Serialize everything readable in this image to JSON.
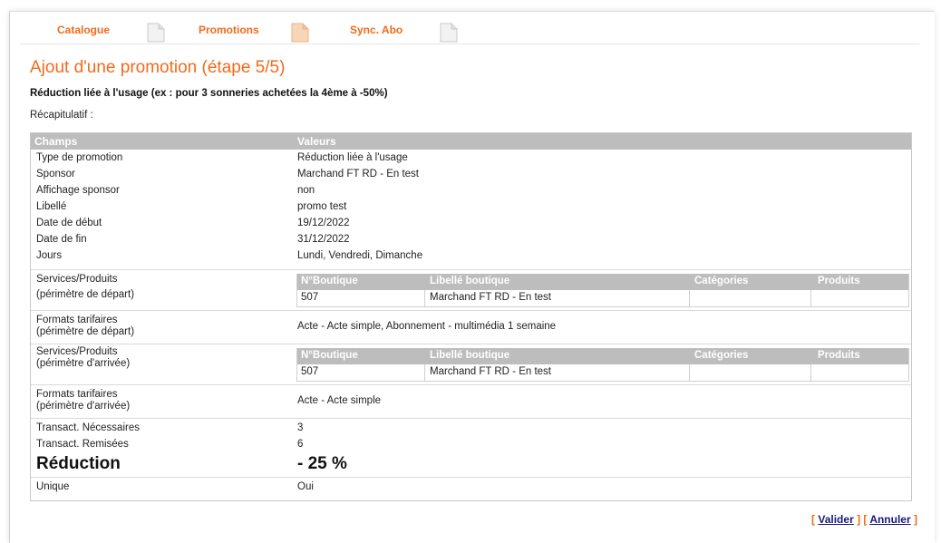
{
  "tabs": [
    "Catalogue",
    "Promotions",
    "Sync. Abo"
  ],
  "page": {
    "title": "Ajout d'une promotion (étape 5/5)",
    "subtitle": "Réduction liée à l'usage (ex : pour 3 sonneries achetées la 4ème à -50%)",
    "recap_label": "Récapitulatif :"
  },
  "table": {
    "col_fields": "Champs",
    "col_values": "Valeurs",
    "rows": [
      {
        "k": "Type de promotion",
        "v": "Réduction liée à l'usage"
      },
      {
        "k": "Sponsor",
        "v": "Marchand FT RD - En test"
      },
      {
        "k": "Affichage sponsor",
        "v": "non"
      },
      {
        "k": "Libellé",
        "v": "promo test"
      },
      {
        "k": "Date de début",
        "v": "19/12/2022"
      },
      {
        "k": "Date de fin",
        "v": "31/12/2022"
      },
      {
        "k": "Jours",
        "v": "Lundi, Vendredi, Dimanche"
      }
    ],
    "services_depart": {
      "label1": "Services/Produits",
      "label2": "(périmètre de départ)"
    },
    "formats_depart": {
      "label1": "Formats tarifaires",
      "label2": "(périmètre de départ)",
      "value": "Acte - Acte simple, Abonnement - multimédia 1 semaine"
    },
    "services_arrivee": {
      "label1": "Services/Produits",
      "label2": "(périmètre d'arrivée)"
    },
    "formats_arrivee": {
      "label1": "Formats tarifaires",
      "label2": "(périmètre d'arrivée)",
      "value": "Acte - Acte simple"
    },
    "inner_headers": [
      "N°Boutique",
      "Libellé boutique",
      "Catégories",
      "Produits"
    ],
    "inner_row": {
      "boutique": "507",
      "libelle": "Marchand FT RD - En test",
      "categories": "",
      "produits": ""
    },
    "transact_nec": {
      "k": "Transact. Nécessaires",
      "v": "3"
    },
    "transact_rem": {
      "k": "Transact. Remisées",
      "v": "6"
    },
    "reduction": {
      "k": "Réduction",
      "v": "- 25 %"
    },
    "unique": {
      "k": "Unique",
      "v": "Oui"
    }
  },
  "actions": {
    "valider": "Valider",
    "annuler": "Annuler",
    "bracket_open": "[",
    "bracket_close": "]"
  },
  "colors": {
    "accent": "#f26a1b",
    "header_bg": "#bdbdbd",
    "link": "#1a1a7a"
  }
}
